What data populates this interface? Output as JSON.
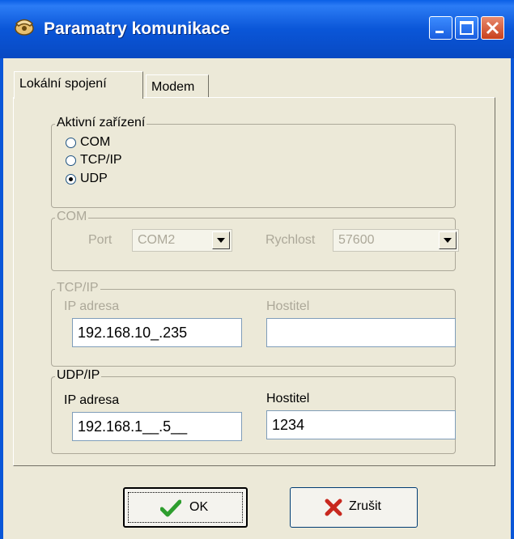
{
  "window": {
    "title": "Paramatry komunikace",
    "icon": "phone-icon",
    "controls": {
      "minimize": "minimize-icon",
      "maximize": "maximize-icon",
      "close": "close-icon"
    }
  },
  "tabs": [
    {
      "label": "Lokální spojení",
      "active": true
    },
    {
      "label": "Modem",
      "active": false
    }
  ],
  "active_device": {
    "legend": "Aktivní zařízení",
    "options": [
      {
        "label": "COM",
        "checked": false
      },
      {
        "label": "TCP/IP",
        "checked": false
      },
      {
        "label": "UDP",
        "checked": true
      }
    ]
  },
  "com": {
    "legend": "COM",
    "port_label": "Port",
    "port_value": "COM2",
    "speed_label": "Rychlost",
    "speed_value": "57600"
  },
  "tcp": {
    "legend": "TCP/IP",
    "ip_label": "IP adresa",
    "ip_value": "192.168.10_.235",
    "host_label": "Hostitel",
    "host_value": ""
  },
  "udp": {
    "legend": "UDP/IP",
    "ip_label": "IP adresa",
    "ip_value": "192.168.1__.5__",
    "host_label": "Hostitel",
    "host_value": "1234"
  },
  "buttons": {
    "ok_label": "OK",
    "cancel_label": "Zrušit"
  },
  "colors": {
    "titlebar": "#0A56D8",
    "face": "#ECE9D8",
    "ok_check": "#2E9E2E",
    "cancel_x": "#C8281E"
  }
}
